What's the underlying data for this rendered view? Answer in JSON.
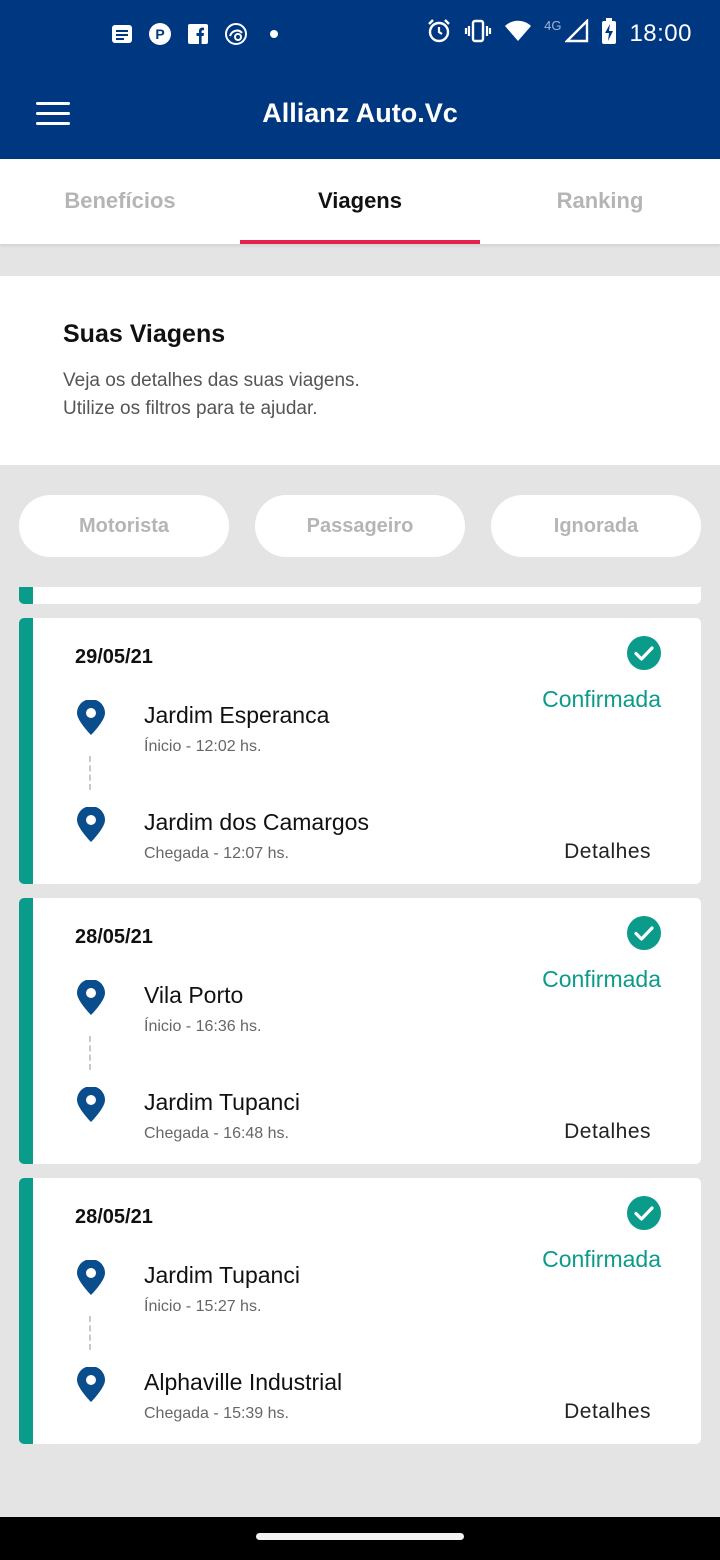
{
  "status_bar": {
    "time": "18:00",
    "network_type": "4G",
    "left_icons": [
      "news-notification-icon",
      "parking-app-icon",
      "facebook-icon",
      "sync-app-icon",
      "dot-icon"
    ],
    "right_icons": [
      "alarm-icon",
      "vibrate-icon",
      "wifi-icon",
      "signal-icon",
      "battery-charging-icon"
    ]
  },
  "app_bar": {
    "title": "Allianz Auto.Vc",
    "menu_icon": "hamburger-menu-icon"
  },
  "tabs": [
    {
      "label": "Benefícios",
      "active": false
    },
    {
      "label": "Viagens",
      "active": true
    },
    {
      "label": "Ranking",
      "active": false
    }
  ],
  "intro": {
    "title": "Suas Viagens",
    "line1": "Veja os detalhes das suas viagens.",
    "line2": "Utilize os filtros para te ajudar."
  },
  "filters": [
    "Motorista",
    "Passageiro",
    "Ignorada"
  ],
  "colors": {
    "brand": "#003781",
    "accent_tab": "#e3234b",
    "confirmed": "#0a9b8a",
    "pin": "#0a4d8c"
  },
  "trips": [
    {
      "date": "29/05/21",
      "status": "Confirmada",
      "start_place": "Jardim Esperanca",
      "start_time": "Ínicio - 12:02 hs.",
      "end_place": "Jardim dos Camargos",
      "end_time": "Chegada - 12:07 hs.",
      "details_label": "Detalhes"
    },
    {
      "date": "28/05/21",
      "status": "Confirmada",
      "start_place": "Vila Porto",
      "start_time": "Ínicio - 16:36 hs.",
      "end_place": "Jardim Tupanci",
      "end_time": "Chegada - 16:48 hs.",
      "details_label": "Detalhes"
    },
    {
      "date": "28/05/21",
      "status": "Confirmada",
      "start_place": "Jardim Tupanci",
      "start_time": "Ínicio - 15:27 hs.",
      "end_place": "Alphaville Industrial",
      "end_time": "Chegada - 15:39 hs.",
      "details_label": "Detalhes"
    }
  ]
}
